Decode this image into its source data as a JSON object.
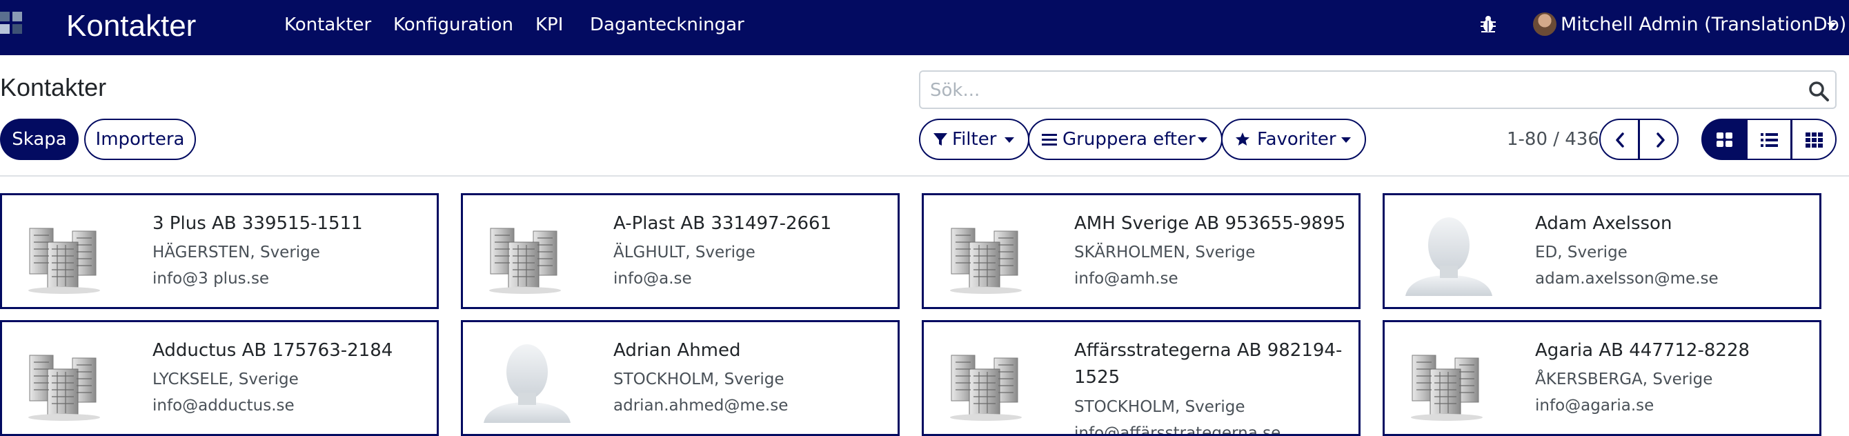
{
  "navbar": {
    "brand": "Kontakter",
    "menu": [
      "Kontakter",
      "Konfiguration",
      "KPI",
      "Daganteckningar"
    ],
    "user": "Mitchell Admin (TranslationDb)",
    "colors": {
      "bar": "#030b61",
      "apps": [
        "#5a6f8f",
        "#8a9bb5",
        "#b7c4d8",
        "#3e5275"
      ]
    }
  },
  "control": {
    "title": "Kontakter",
    "search_placeholder": "Sök...",
    "create": "Skapa",
    "import": "Importera",
    "filter": "Filter",
    "group_by": "Gruppera efter",
    "favorites": "Favoriter",
    "pager": "1-80 / 436"
  },
  "cards": [
    {
      "type": "company",
      "name": "3 Plus AB 339515-1511",
      "location": "HÄGERSTEN, Sverige",
      "email": "info@3 plus.se"
    },
    {
      "type": "company",
      "name": "A-Plast AB 331497-2661",
      "location": "ÄLGHULT, Sverige",
      "email": "info@a.se"
    },
    {
      "type": "company",
      "name": "AMH Sverige AB 953655-9895",
      "location": "SKÄRHOLMEN, Sverige",
      "email": "info@amh.se"
    },
    {
      "type": "person",
      "name": "Adam Axelsson",
      "location": "ED, Sverige",
      "email": "adam.axelsson@me.se"
    },
    {
      "type": "company",
      "name": "Adductus AB 175763-2184",
      "location": "LYCKSELE, Sverige",
      "email": "info@adductus.se"
    },
    {
      "type": "person",
      "name": "Adrian Ahmed",
      "location": "STOCKHOLM, Sverige",
      "email": "adrian.ahmed@me.se"
    },
    {
      "type": "company",
      "name": "Affärsstrategerna AB 982194-1525",
      "location": "STOCKHOLM, Sverige",
      "email": "info@affärsstrategerna.se"
    },
    {
      "type": "company",
      "name": "Agaria AB 447712-8228",
      "location": "ÅKERSBERGA, Sverige",
      "email": "info@agaria.se"
    }
  ]
}
